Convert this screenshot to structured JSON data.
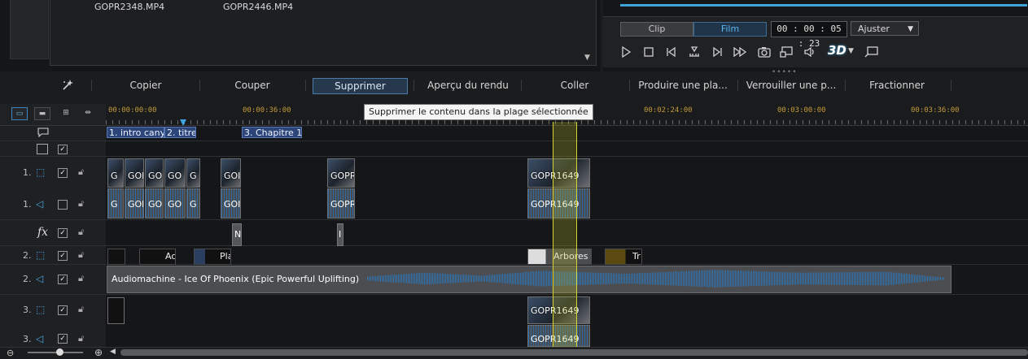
{
  "library": {
    "media": [
      "GOPR2348.MP4",
      "GOPR2446.MP4"
    ]
  },
  "preview": {
    "mode_clip": "Clip",
    "mode_film": "Film",
    "timecode": "00 : 00 : 05 : 23",
    "fit": "Ajuster",
    "badge_3d": "3D"
  },
  "toolbar": {
    "copy": "Copier",
    "cut": "Couper",
    "delete": "Supprimer",
    "render_preview": "Aperçu du rendu",
    "paste": "Coller",
    "produce_range": "Produire une pla...",
    "lock_range": "Verrouiller une p...",
    "split": "Fractionner"
  },
  "tooltip": "Supprimer le contenu dans la plage sélectionnée",
  "ruler": {
    "labels": [
      "00:00:00:00",
      "00:00:36:00",
      "00:02:24:00",
      "00:03:00:00",
      "00:03:36:00"
    ]
  },
  "chapters": [
    "1. intro cany",
    "2. titre",
    "3. Chapitre 1"
  ],
  "track_numbers": {
    "video1": "1.",
    "audio1": "1.",
    "video2": "2.",
    "audio2": "2.",
    "video3": "3.",
    "audio3": "3."
  },
  "clips": {
    "video1": [
      "G",
      "GOP",
      "GO",
      "GO",
      "G",
      "GOI",
      "GOPR",
      "GOPR1649"
    ],
    "audio1": [
      "G",
      "GOP",
      "GO",
      "GO",
      "G",
      "GOI",
      "GOPR",
      "GOPR1649"
    ],
    "fx": [
      "N",
      "I"
    ],
    "video2": [
      "Ac",
      "Pla",
      "Arbores",
      "Tr"
    ],
    "music": "Audiomachine - Ice Of Phoenix (Epic Powerful Uplifting)",
    "video3": [
      "GOPR1649"
    ],
    "audio3": [
      "GOPR1649"
    ]
  },
  "icons": {
    "wand": "magic-wand-icon",
    "chapter": "chapter-marker-icon",
    "subtitle": "subtitle-icon",
    "video": "video-track-icon",
    "audio": "audio-track-icon",
    "fx": "fx-icon",
    "lock": "lock-icon"
  },
  "colors": {
    "accent": "#3fa3d8",
    "timecode": "#c49a3a",
    "selection": "#d6d330",
    "chapter": "#2c4579",
    "audio_wave": "#2f72b0"
  }
}
